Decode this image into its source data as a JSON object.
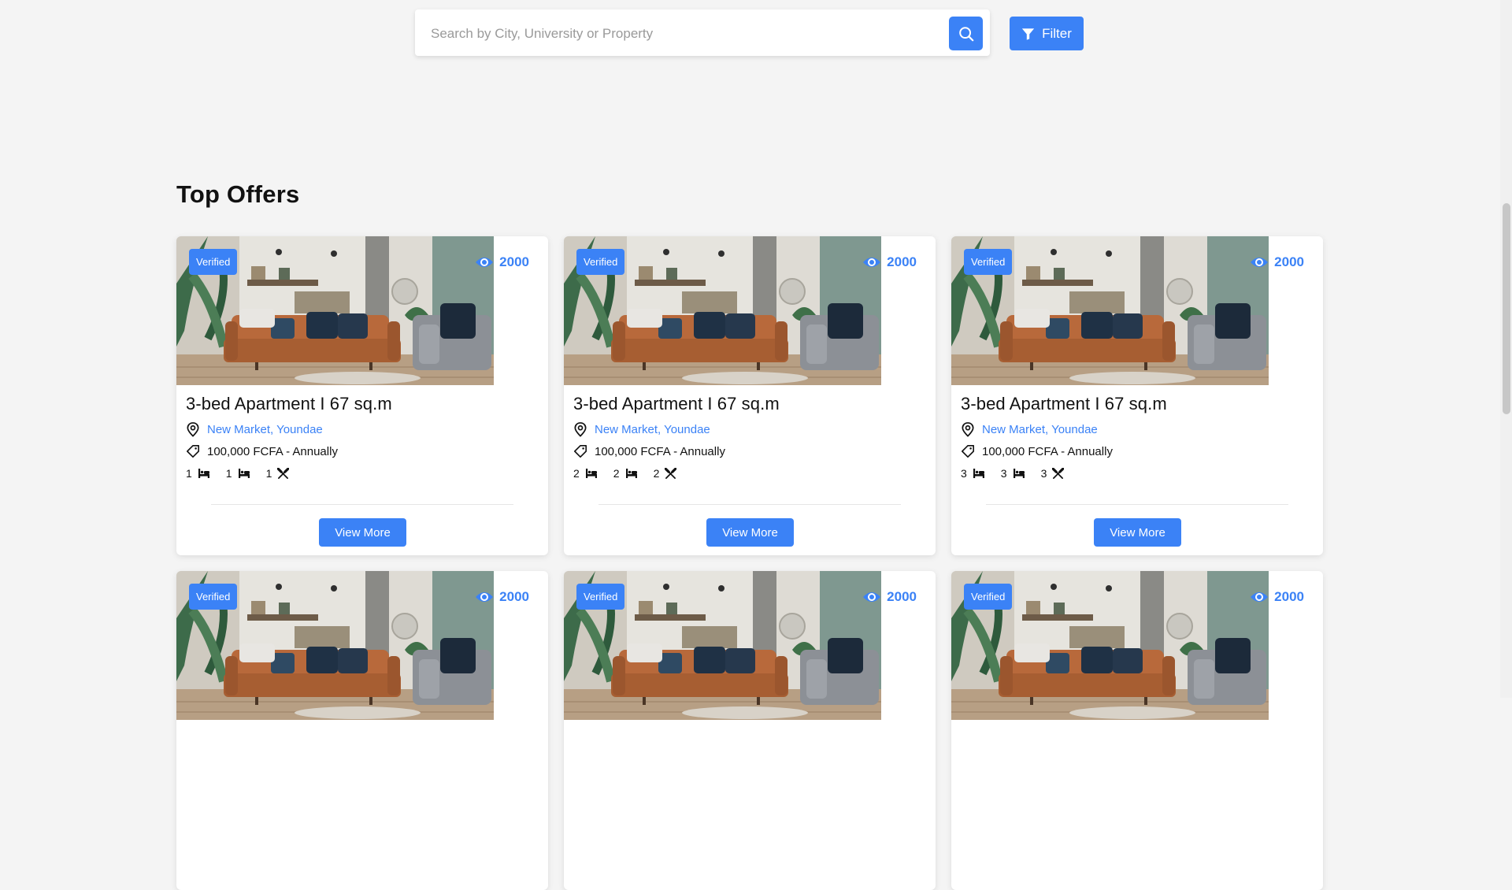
{
  "search": {
    "placeholder": "Search by City, University or Property",
    "value": ""
  },
  "filter": {
    "label": "Filter"
  },
  "section": {
    "title": "Top Offers"
  },
  "colors": {
    "accent": "#3b82f6",
    "background": "#f4f4f4"
  },
  "listings": [
    {
      "badge": "Verified",
      "views": "2000",
      "title": "3-bed Apartment I 67 sq.m",
      "location": "New Market, Youndae",
      "price": "100,000 FCFA - Annually",
      "amenities": [
        {
          "count": "1",
          "icon": "bed-icon"
        },
        {
          "count": "1",
          "icon": "bed-icon"
        },
        {
          "count": "1",
          "icon": "kitchen-utensils-icon"
        }
      ],
      "button": "View More"
    },
    {
      "badge": "Verified",
      "views": "2000",
      "title": "3-bed Apartment I 67 sq.m",
      "location": "New Market, Youndae",
      "price": "100,000 FCFA - Annually",
      "amenities": [
        {
          "count": "2",
          "icon": "bed-icon"
        },
        {
          "count": "2",
          "icon": "bed-icon"
        },
        {
          "count": "2",
          "icon": "kitchen-utensils-icon"
        }
      ],
      "button": "View More"
    },
    {
      "badge": "Verified",
      "views": "2000",
      "title": "3-bed Apartment I 67 sq.m",
      "location": "New Market, Youndae",
      "price": "100,000 FCFA - Annually",
      "amenities": [
        {
          "count": "3",
          "icon": "bed-icon"
        },
        {
          "count": "3",
          "icon": "bed-icon"
        },
        {
          "count": "3",
          "icon": "kitchen-utensils-icon"
        }
      ],
      "button": "View More"
    },
    {
      "badge": "Verified",
      "views": "2000"
    },
    {
      "badge": "Verified",
      "views": "2000"
    },
    {
      "badge": "Verified",
      "views": "2000"
    }
  ]
}
